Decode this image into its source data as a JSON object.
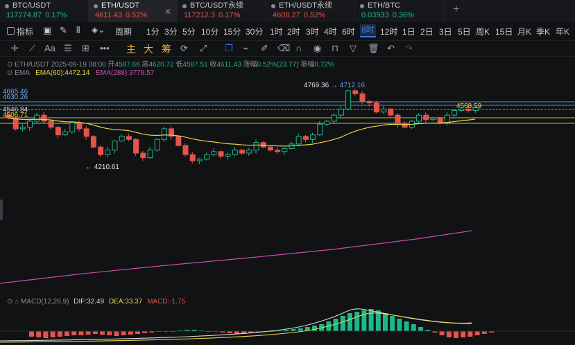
{
  "tickers": [
    {
      "symbol": "BTC/USDT",
      "price": "117274.87",
      "pct": "0.17%",
      "trend": "green"
    },
    {
      "symbol": "ETH/USDT",
      "price": "4611.43",
      "pct": "0.52%",
      "trend": "red",
      "active": true
    },
    {
      "symbol": "BTC/USDT永续",
      "price": "117212.3",
      "pct": "0.17%",
      "trend": "red"
    },
    {
      "symbol": "ETH/USDT永续",
      "price": "4609.27",
      "pct": "0.52%",
      "trend": "red"
    },
    {
      "symbol": "ETH/BTC",
      "price": "0.03933",
      "pct": "0.36%",
      "trend": "green"
    }
  ],
  "add_tab": "+",
  "toolbar": {
    "indicators": "指标",
    "period": "周期",
    "timeframes": [
      "1分",
      "3分",
      "5分",
      "10分",
      "15分",
      "30分",
      "1时",
      "2时",
      "3时",
      "4时",
      "6时",
      "8时",
      "12时",
      "1日",
      "2日",
      "3日",
      "5日",
      "周K",
      "15日",
      "月K",
      "季K",
      "年K"
    ],
    "selected": "8时"
  },
  "drawtools": {
    "main": "主",
    "big": "大",
    "chip": "筹",
    "text": "Aa",
    "more": "•••"
  },
  "legend": {
    "symbol": "ETH/USDT",
    "date": "2025-09-19 08:00",
    "open_label": "开",
    "open": "4587.66",
    "high_label": "高",
    "high": "4620.72",
    "low_label": "低",
    "low": "4587.51",
    "close_label": "收",
    "close": "4611.43",
    "chg_label": "涨幅",
    "chg": "0.52%(23.77)",
    "amp_label": "振幅",
    "amp": "0.72%",
    "ema_title": "EMA",
    "ema60": "EMA(60):4472.14",
    "ema288": "EMA(288):3778.57"
  },
  "macd_legend": {
    "title": "MACD(12,26,9)",
    "dif": "DIF:32.49",
    "dea": "DEA:33.37",
    "macd": "MACD:-1.75"
  },
  "price_levels": {
    "l1": "4665.46",
    "l2": "4630.26",
    "l3": "4546.84",
    "l4": "4506.71"
  },
  "annotations": {
    "high": "4769.36",
    "high_arrow": "→ 4712.16",
    "low": "← 4210.61",
    "last": "4568.59"
  },
  "colors": {
    "up": "#19b98a",
    "down": "#e5534b",
    "ema60": "#e8d44d",
    "ema288": "#c94ea8",
    "accent": "#2f7cf6"
  },
  "chart_data": {
    "type": "candlestick",
    "symbol": "ETH/USDT",
    "interval": "8时",
    "close_approx": [
      4540,
      4470,
      4480,
      4520,
      4560,
      4520,
      4480,
      4430,
      4450,
      4510,
      4470,
      4420,
      4350,
      4300,
      4330,
      4390,
      4420,
      4400,
      4310,
      4280,
      4330,
      4400,
      4470,
      4420,
      4360,
      4300,
      4260,
      4270,
      4300,
      4320,
      4290,
      4300,
      4330,
      4310,
      4330,
      4380,
      4350,
      4330,
      4320,
      4340,
      4370,
      4420,
      4400,
      4430,
      4500,
      4520,
      4560,
      4600,
      4720,
      4700,
      4650,
      4640,
      4580,
      4600,
      4560,
      4500,
      4480,
      4520,
      4560,
      4530,
      4540,
      4510,
      4560,
      4590,
      4600,
      4590,
      4611
    ]
  }
}
